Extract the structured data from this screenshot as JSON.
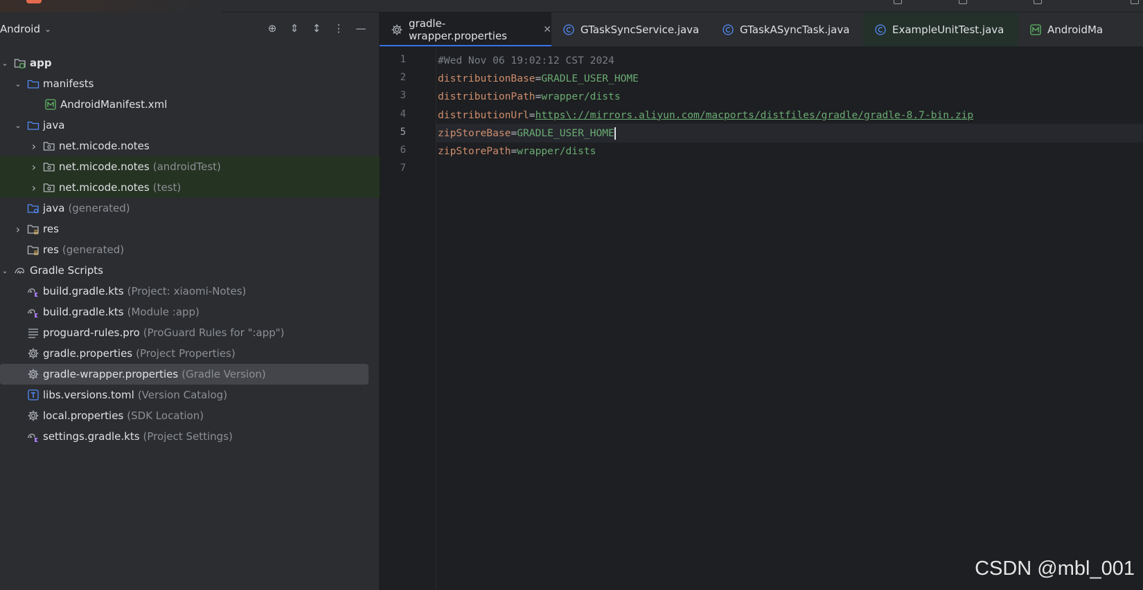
{
  "project_panel": {
    "title": "Android",
    "tree": [
      {
        "label": "app",
        "sub": "",
        "bold": true,
        "indent": 0,
        "arrow": "down",
        "icon": "module-folder-icon"
      },
      {
        "label": "manifests",
        "sub": "",
        "indent": 1,
        "arrow": "down",
        "icon": "folder-icon"
      },
      {
        "label": "AndroidManifest.xml",
        "sub": "",
        "indent": 2,
        "arrow": "",
        "icon": "manifest-file-icon"
      },
      {
        "label": "java",
        "sub": "",
        "indent": 1,
        "arrow": "down",
        "icon": "folder-icon"
      },
      {
        "label": "net.micode.notes",
        "sub": "",
        "indent": 2,
        "arrow": "right",
        "icon": "package-icon"
      },
      {
        "label": "net.micode.notes",
        "sub": "(androidTest)",
        "indent": 2,
        "arrow": "right",
        "icon": "package-icon",
        "hl": "green"
      },
      {
        "label": "net.micode.notes",
        "sub": "(test)",
        "indent": 2,
        "arrow": "right",
        "icon": "package-icon",
        "hl": "green"
      },
      {
        "label": "java",
        "sub": "(generated)",
        "indent": 1,
        "arrow": "",
        "icon": "generated-folder-icon"
      },
      {
        "label": "res",
        "sub": "",
        "indent": 1,
        "arrow": "right",
        "icon": "res-folder-icon"
      },
      {
        "label": "res",
        "sub": "(generated)",
        "indent": 1,
        "arrow": "",
        "icon": "res-folder-icon"
      },
      {
        "label": "Gradle Scripts",
        "sub": "",
        "indent": 0,
        "arrow": "down",
        "icon": "gradle-icon"
      },
      {
        "label": "build.gradle.kts",
        "sub": "(Project: xiaomi-Notes)",
        "indent": 1,
        "arrow": "",
        "icon": "gradle-kts-icon"
      },
      {
        "label": "build.gradle.kts",
        "sub": "(Module :app)",
        "indent": 1,
        "arrow": "",
        "icon": "gradle-kts-icon"
      },
      {
        "label": "proguard-rules.pro",
        "sub": "(ProGuard Rules for \":app\")",
        "indent": 1,
        "arrow": "",
        "icon": "text-file-icon"
      },
      {
        "label": "gradle.properties",
        "sub": "(Project Properties)",
        "indent": 1,
        "arrow": "",
        "icon": "gear-icon"
      },
      {
        "label": "gradle-wrapper.properties",
        "sub": "(Gradle Version)",
        "indent": 1,
        "arrow": "",
        "icon": "gear-icon",
        "selected": true
      },
      {
        "label": "libs.versions.toml",
        "sub": "(Version Catalog)",
        "indent": 1,
        "arrow": "",
        "icon": "toml-file-icon"
      },
      {
        "label": "local.properties",
        "sub": "(SDK Location)",
        "indent": 1,
        "arrow": "",
        "icon": "gear-icon"
      },
      {
        "label": "settings.gradle.kts",
        "sub": "(Project Settings)",
        "indent": 1,
        "arrow": "",
        "icon": "gradle-kts-icon"
      }
    ]
  },
  "tabs": [
    {
      "label": "gradle-wrapper.properties",
      "icon": "gear-icon",
      "active": true
    },
    {
      "label": "GTaskSyncService.java",
      "icon": "class-icon"
    },
    {
      "label": "GTaskASyncTask.java",
      "icon": "class-icon"
    },
    {
      "label": "ExampleUnitTest.java",
      "icon": "class-icon",
      "tinted": true
    },
    {
      "label": "AndroidMa",
      "icon": "manifest-file-icon"
    }
  ],
  "editor": {
    "current_line": 5,
    "lines": [
      {
        "n": "1",
        "comment": "#Wed Nov 06 19:02:12 CST 2024"
      },
      {
        "n": "2",
        "key": "distributionBase",
        "value": "GRADLE_USER_HOME"
      },
      {
        "n": "3",
        "key": "distributionPath",
        "value": "wrapper/dists"
      },
      {
        "n": "4",
        "key": "distributionUrl",
        "value": "https\\://mirrors.aliyun.com/macports/distfiles/gradle/gradle-8.7-bin.zip",
        "link": true
      },
      {
        "n": "5",
        "key": "zipStoreBase",
        "value": "GRADLE_USER_HOME"
      },
      {
        "n": "6",
        "key": "zipStorePath",
        "value": "wrapper/dists"
      },
      {
        "n": "7"
      }
    ]
  },
  "watermark": "CSDN @mbl_001",
  "colors": {
    "accent": "#3574f0",
    "key": "#cf8e6d",
    "value": "#6aab73",
    "selection": "#43454a"
  }
}
